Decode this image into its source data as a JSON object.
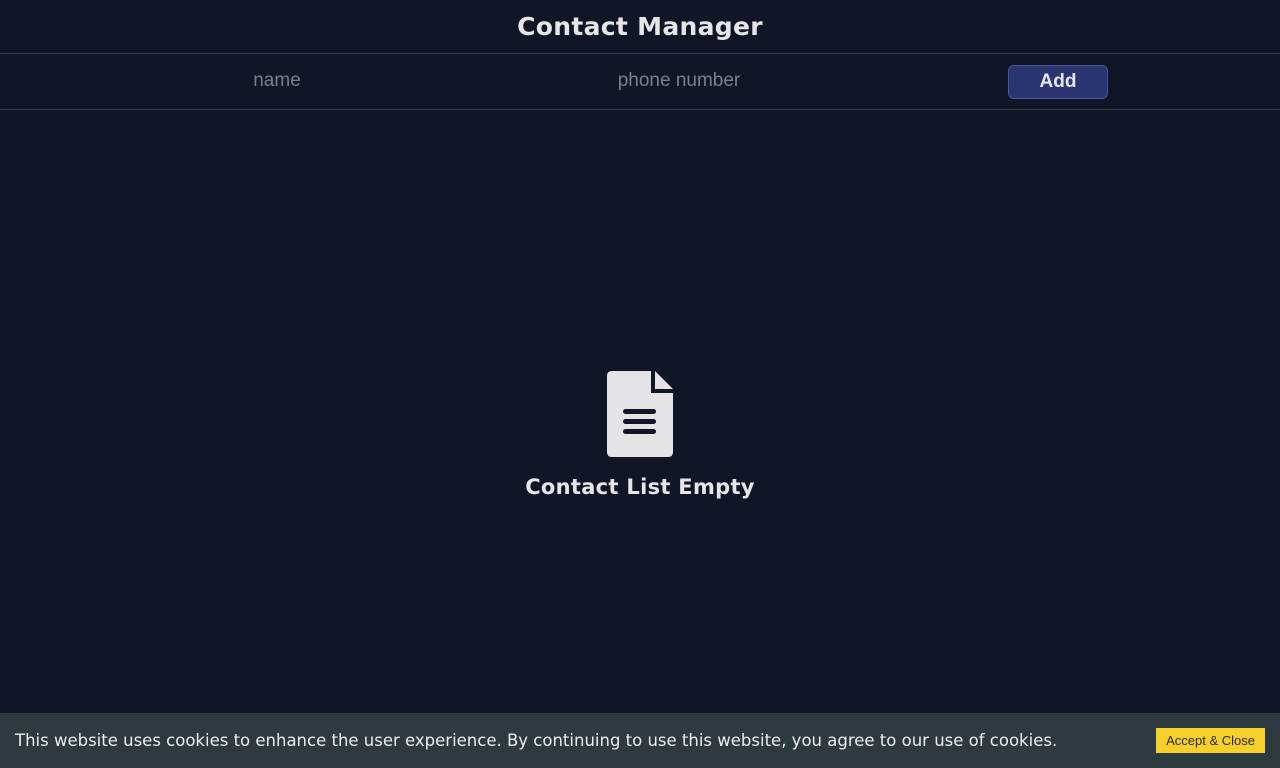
{
  "header": {
    "title": "Contact Manager"
  },
  "form": {
    "name_placeholder": "name",
    "phone_placeholder": "phone number",
    "add_label": "Add"
  },
  "empty_state": {
    "icon": "document-icon",
    "message": "Contact List Empty"
  },
  "cookie_banner": {
    "message": "This website uses cookies to enhance the user experience. By continuing to use this website, you agree to our use of cookies.",
    "accept_label": "Accept & Close"
  },
  "colors": {
    "background": "#111627",
    "add_button": "#2b3572",
    "cookie_banner": "#2d3a3f",
    "cookie_button": "#f6cf2a"
  }
}
